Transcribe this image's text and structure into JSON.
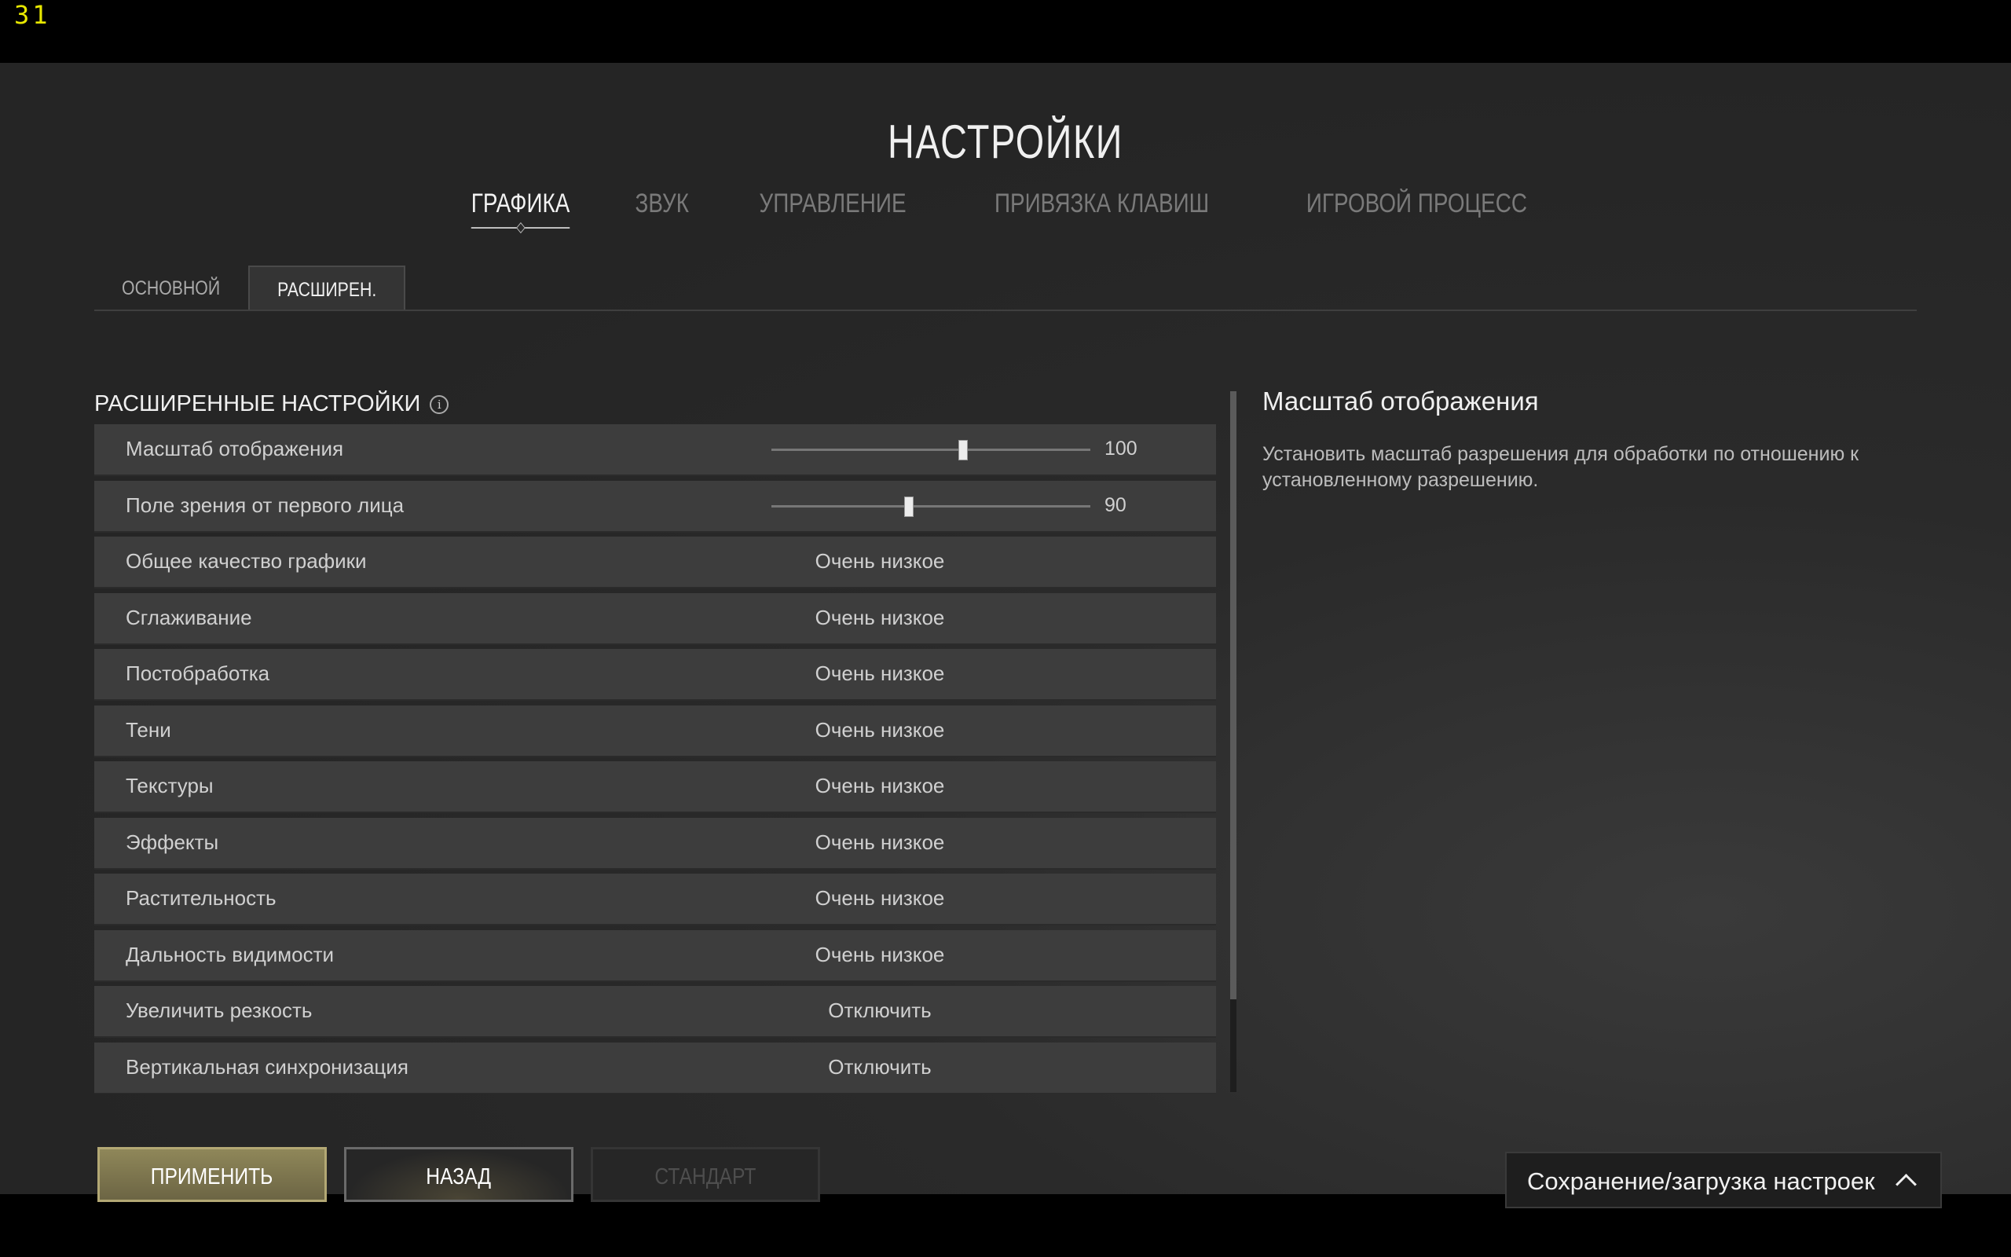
{
  "fps_counter": "31",
  "title": "НАСТРОЙКИ",
  "main_tabs": [
    {
      "label": "ГРАФИКА",
      "active": true
    },
    {
      "label": "ЗВУК",
      "active": false
    },
    {
      "label": "УПРАВЛЕНИЕ",
      "active": false
    },
    {
      "label": "ПРИВЯЗКА КЛАВИШ",
      "active": false
    },
    {
      "label": "ИГРОВОЙ ПРОЦЕСС",
      "active": false
    }
  ],
  "sub_tabs": [
    {
      "label": "ОСНОВНОЙ",
      "active": false
    },
    {
      "label": "РАСШИРЕН.",
      "active": true
    }
  ],
  "section": {
    "title": "РАСШИРЕННЫЕ НАСТРОЙКИ",
    "info_icon": "info-icon"
  },
  "sliders": [
    {
      "label": "Масштаб отображения",
      "value": "100",
      "fraction": 0.6
    },
    {
      "label": "Поле зрения от первого лица",
      "value": "90",
      "fraction": 0.43
    }
  ],
  "options": [
    {
      "label": "Общее качество графики",
      "value": "Очень низкое"
    },
    {
      "label": "Сглаживание",
      "value": "Очень низкое"
    },
    {
      "label": "Постобработка",
      "value": "Очень низкое"
    },
    {
      "label": "Тени",
      "value": "Очень низкое"
    },
    {
      "label": "Текстуры",
      "value": "Очень низкое"
    },
    {
      "label": "Эффекты",
      "value": "Очень низкое"
    },
    {
      "label": "Растительность",
      "value": "Очень низкое"
    },
    {
      "label": "Дальность видимости",
      "value": "Очень низкое"
    },
    {
      "label": "Увеличить резкость",
      "value": "Отключить"
    },
    {
      "label": "Вертикальная синхронизация",
      "value": "Отключить"
    }
  ],
  "description": {
    "title": "Масштаб отображения",
    "text": "Установить масштаб разрешения для обработки по отношению к установленному разрешению."
  },
  "buttons": {
    "apply": "ПРИМЕНИТЬ",
    "back": "НАЗАД",
    "default": "СТАНДАРТ"
  },
  "save_load": {
    "label": "Сохранение/загрузка настроек",
    "icon": "chevron-up-icon"
  }
}
